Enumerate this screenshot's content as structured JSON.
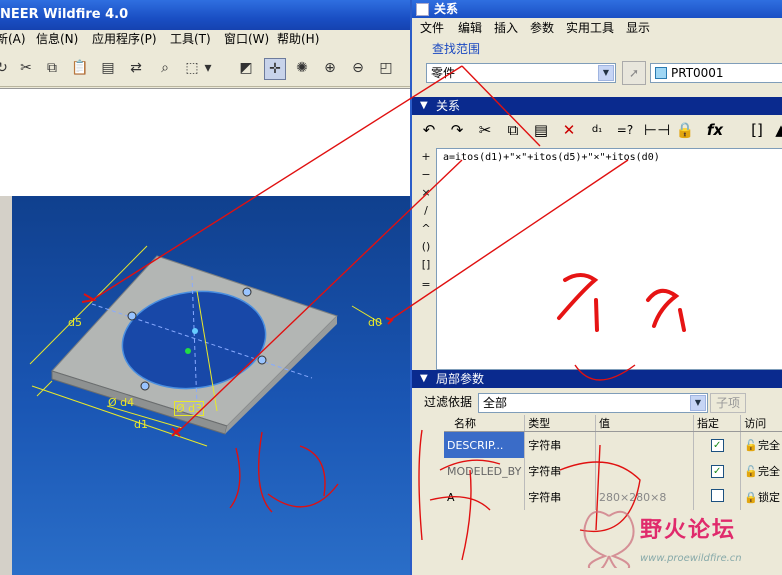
{
  "left_window": {
    "title": "NEER Wildfire 4.0",
    "menu": [
      "新(A)",
      "信息(N)",
      "应用程序(P)",
      "工具(T)",
      "窗口(W)",
      "帮助(H)"
    ],
    "toolbar_icons": [
      "repaint-icon",
      "cut-icon",
      "copy-icon",
      "paste-icon",
      "paste-special-icon",
      "regenerate-icon",
      "find-icon",
      "select-box-icon",
      "dropdown-icon",
      "datum-plane-icon",
      "datum-axis-icon",
      "spin-center-icon",
      "zoom-in-icon",
      "zoom-out-icon",
      "refit-icon"
    ],
    "dims": {
      "d5": "d5",
      "d4": "Ø d4",
      "d3": "Ø d3",
      "d1": "d1",
      "d0": "d0"
    }
  },
  "relations_dialog": {
    "title": "关系",
    "menu": [
      "文件",
      "编辑",
      "插入",
      "参数",
      "实用工具",
      "显示"
    ],
    "lookup_label": "查找范围",
    "scope_value": "零件",
    "model_value": "PRT0001",
    "relations_section": "关系",
    "toolbar_icons": [
      "undo-icon",
      "redo-icon",
      "cut-icon",
      "copy-icon",
      "paste-icon",
      "delete-icon",
      "evaluate-icon",
      "verify-icon",
      "measure-icon",
      "lock-icon",
      "function-icon",
      "brackets-icon",
      "sort-icon"
    ],
    "operators": [
      "+",
      "−",
      "×",
      "/",
      "^",
      "()",
      "[]",
      "="
    ],
    "relation_text": "a=itos(d1)+\"×\"+itos(d5)+\"×\"+itos(d0)",
    "local_params_section": "局部参数",
    "filter_label": "过滤依据",
    "filter_value": "全部",
    "filter_button": "子项",
    "columns": [
      "名称",
      "类型",
      "值",
      "指定",
      "访问"
    ],
    "rows": [
      {
        "name": "DESCRIP...",
        "type": "字符串",
        "value": "",
        "designated": true,
        "access": "完全"
      },
      {
        "name": "MODELED_BY",
        "type": "字符串",
        "value": "",
        "designated": true,
        "access": "完全"
      },
      {
        "name": "A",
        "type": "字符串",
        "value": "280×280×8",
        "designated": false,
        "access": "锁定"
      }
    ]
  },
  "watermark": {
    "text": "野火论坛",
    "url": "www.proewildfire.cn"
  },
  "annotations": {
    "handwriting": "你的"
  }
}
